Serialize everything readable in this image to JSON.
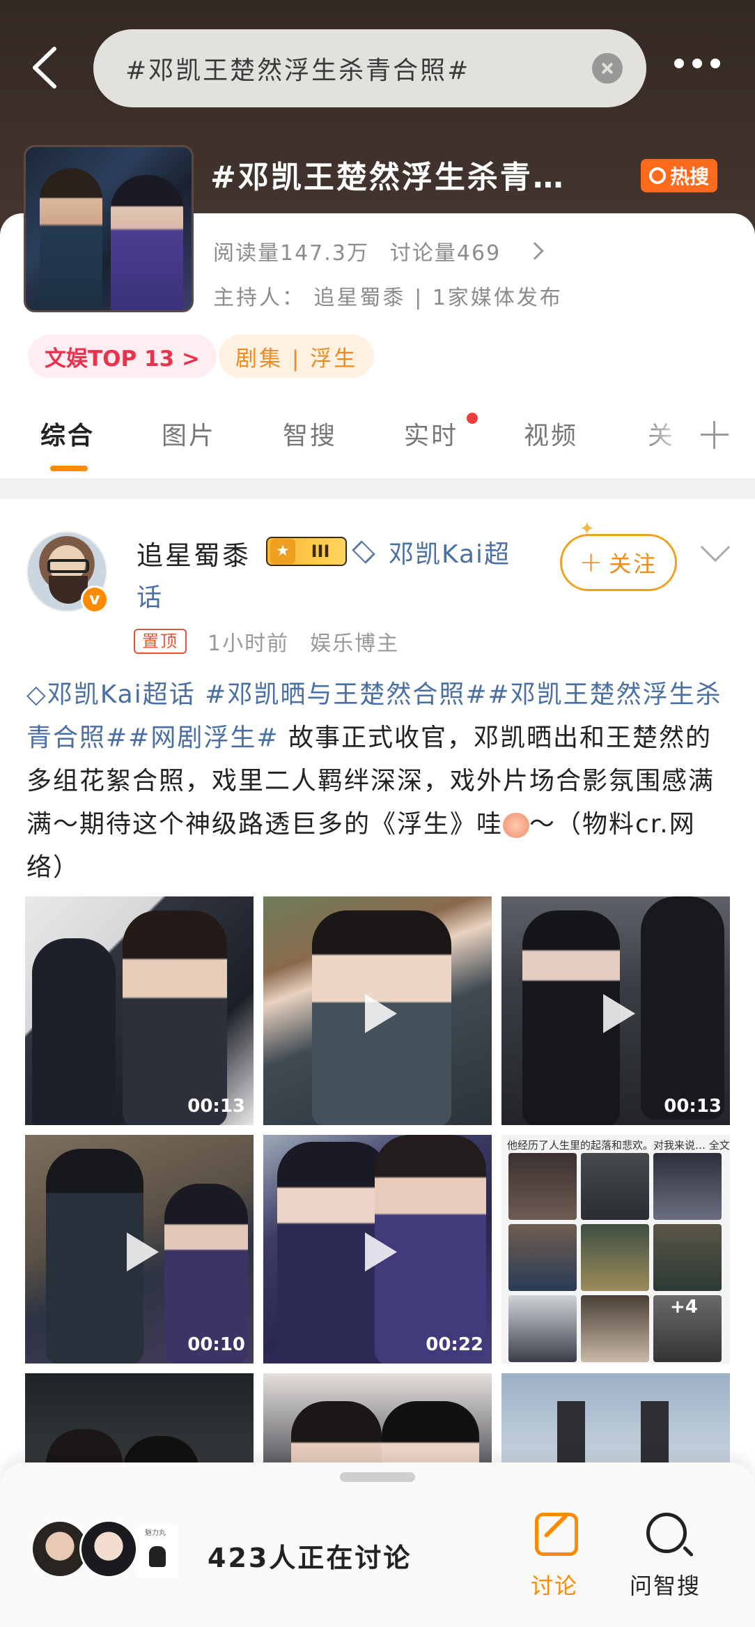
{
  "search": {
    "query": "#邓凯王楚然浮生杀青合照#"
  },
  "topic": {
    "title": "#邓凯王楚然浮生杀青…",
    "hot_badge": "热搜",
    "reads": "阅读量147.3万",
    "discussions": "讨论量469",
    "host": "主持人： 追星蜀黍 | 1家媒体发布",
    "chips": [
      "文娱TOP 13 >",
      "剧集 | 浮生"
    ]
  },
  "tabs": [
    "综合",
    "图片",
    "智搜",
    "实时",
    "视频",
    "关"
  ],
  "post": {
    "author": "追星蜀黍",
    "level": "III",
    "super_topic": "邓凯Kai超",
    "super_topic_cont": "话",
    "follow": "关注",
    "pin": "置顶",
    "time": "1小时前",
    "role": "娱乐博主",
    "body": {
      "link1": "邓凯Kai超话 #邓凯晒与王楚然合照##邓凯王楚然浮生杀青合照##网剧浮生#",
      "text": " 故事正式收官，邓凯晒出和王楚然的多组花絮合照，戏里二人羁绊深深，戏外片场合影氛围感满满～期待这个神级路透巨多的《浮生》哇",
      "tail": "～（物料cr.网络）"
    },
    "media": [
      {
        "duration": "00:13"
      },
      {
        "duration": ""
      },
      {
        "duration": "00:13"
      },
      {
        "duration": "00:10"
      },
      {
        "duration": "00:22"
      }
    ],
    "collage": {
      "caption": "他经历了人生里的起落和悲欢。对我来说…  全文",
      "more": "+4"
    }
  },
  "bottom": {
    "count": "423人正在讨论",
    "discuss": "讨论",
    "zhisou": "问智搜",
    "face_label": "魅力丸"
  },
  "colors": {
    "accent": "#ff8a00",
    "link": "#4a6fa5",
    "hot": "#ff6a1c"
  }
}
